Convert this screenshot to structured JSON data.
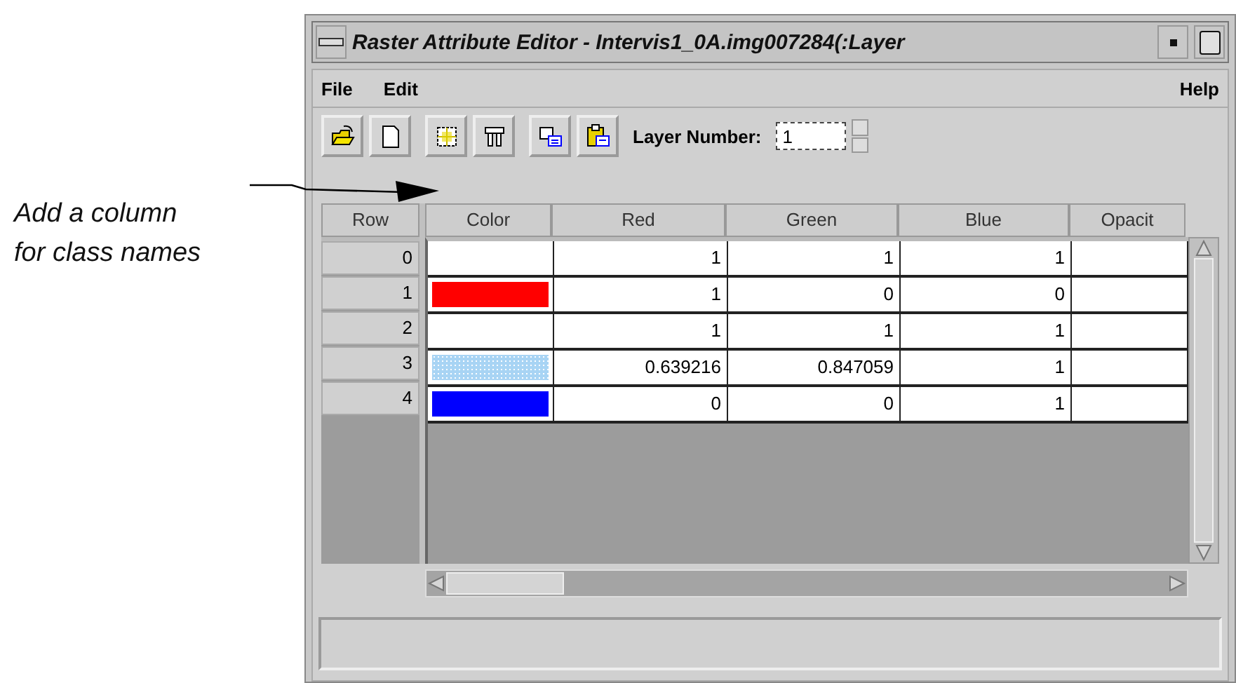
{
  "annotation": {
    "lines": [
      "Add a column",
      "for class names"
    ]
  },
  "window": {
    "title": "Raster Attribute Editor - Intervis1_0A.img007284(:Layer"
  },
  "menu": [
    {
      "label": "File"
    },
    {
      "label": "Edit"
    },
    {
      "label": "Help"
    }
  ],
  "toolbar": {
    "buttons": [
      {
        "kind": "open"
      },
      {
        "kind": "new"
      },
      {
        "kind": "select"
      },
      {
        "kind": "columns"
      },
      {
        "kind": "copy"
      },
      {
        "kind": "paste"
      }
    ],
    "layer_label": "Layer Number:",
    "layer_value": "1"
  },
  "table": {
    "row_header": "Row",
    "columns": [
      "Color",
      "Red",
      "Green",
      "Blue",
      "Opacit"
    ],
    "rows": [
      {
        "row": "0",
        "cells": [
          "1",
          "1",
          "1"
        ]
      },
      {
        "row": "1",
        "color": "#ff0000",
        "cells": [
          "1",
          "0",
          "0"
        ]
      },
      {
        "row": "2",
        "cells": [
          "1",
          "1",
          "1"
        ]
      },
      {
        "row": "3",
        "color": "#a8d4f4",
        "cells": [
          "0.639216",
          "0.847059",
          "1"
        ]
      },
      {
        "row": "4",
        "color": "#0000ff",
        "cells": [
          "0",
          "0",
          "1"
        ]
      }
    ]
  }
}
